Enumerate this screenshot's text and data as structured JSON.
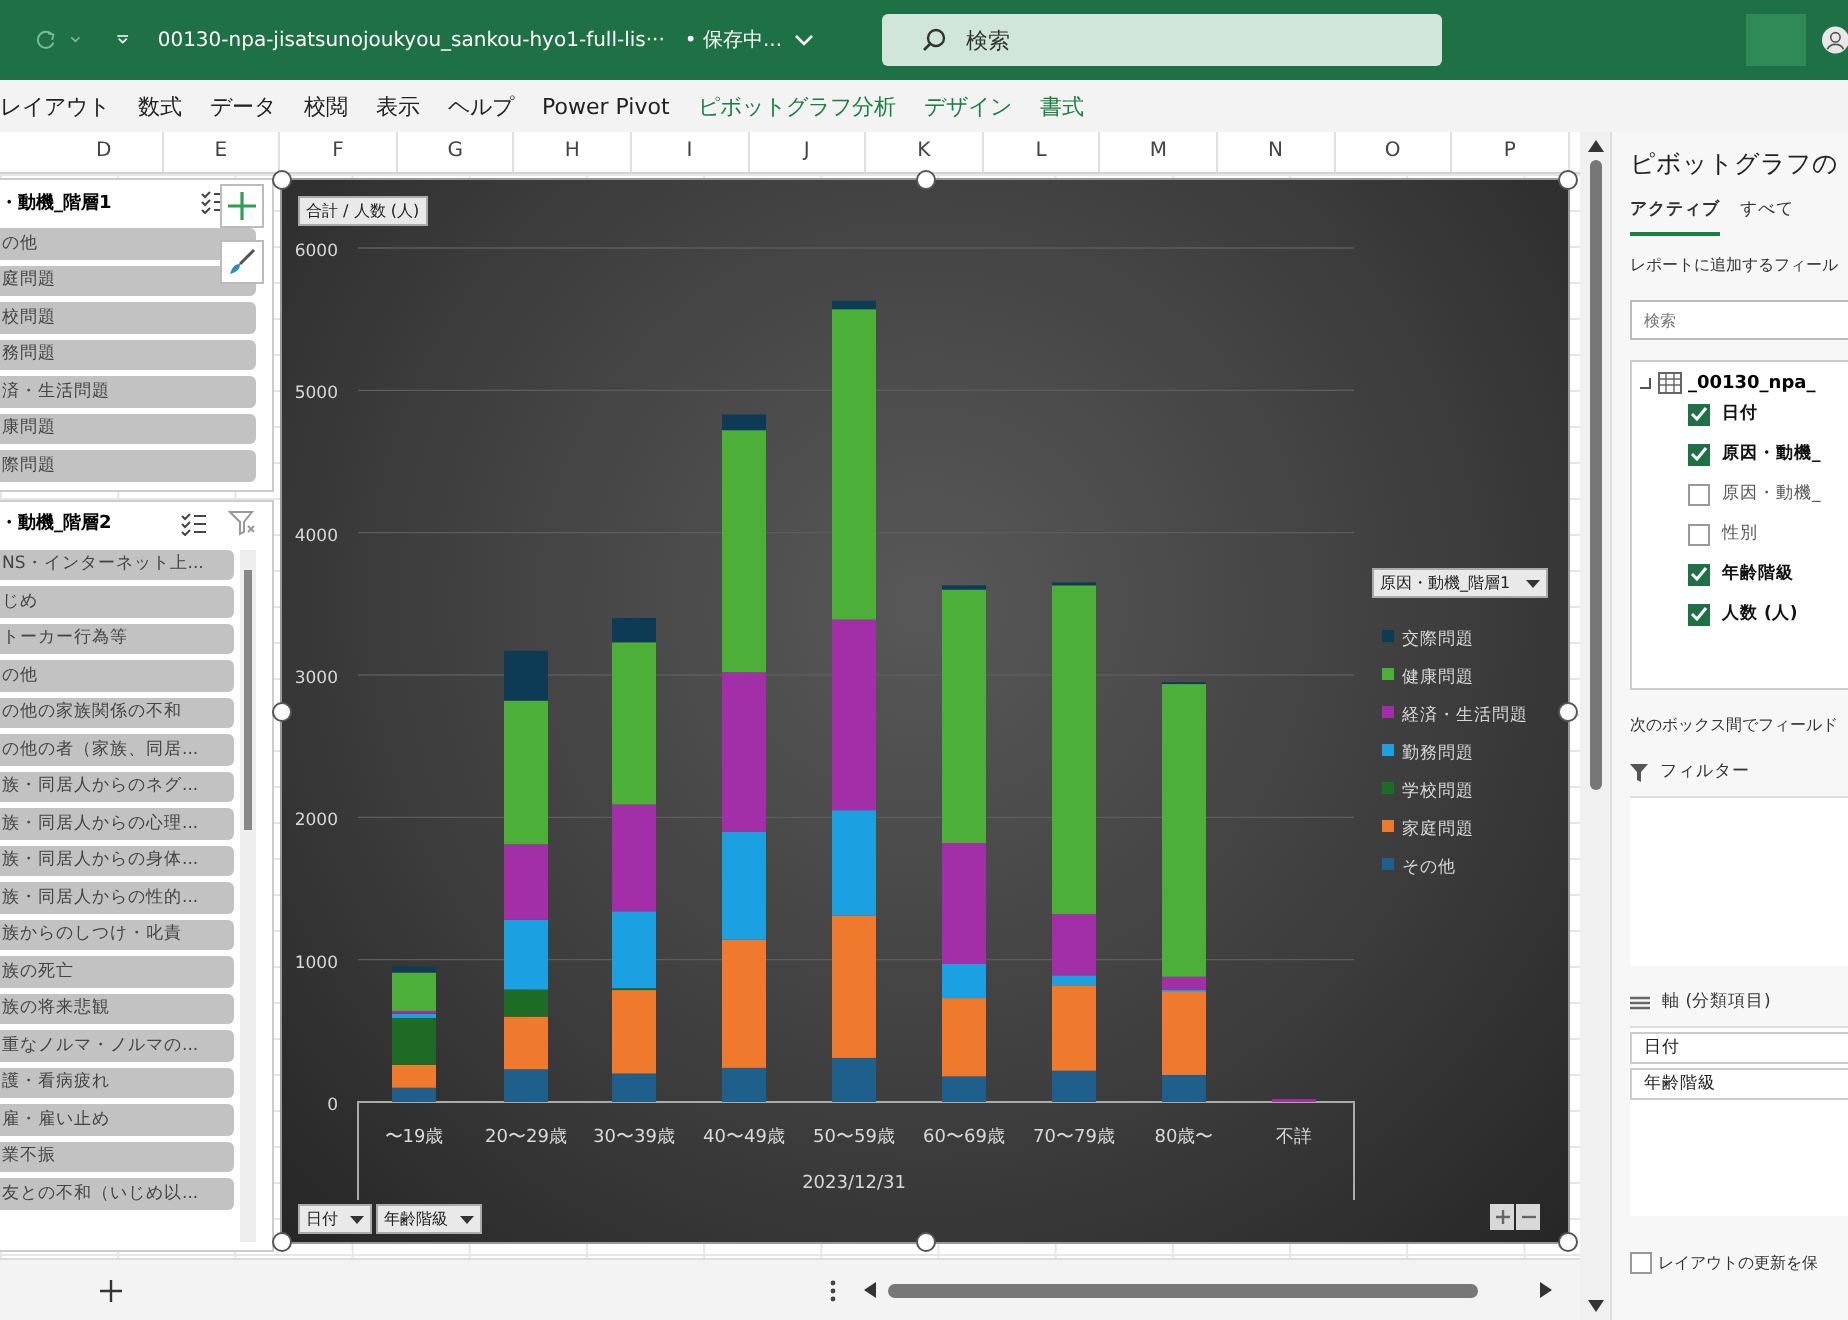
{
  "title_bar": {
    "filename": "00130-npa-jisatsunojoukyou_sankou-hyo1-full-lis···",
    "save_status": "• 保存中...",
    "search_placeholder": "検索"
  },
  "ribbon_tabs": [
    {
      "label": "レイアウト",
      "contextual": false
    },
    {
      "label": "数式",
      "contextual": false
    },
    {
      "label": "データ",
      "contextual": false
    },
    {
      "label": "校閲",
      "contextual": false
    },
    {
      "label": "表示",
      "contextual": false
    },
    {
      "label": "ヘルプ",
      "contextual": false
    },
    {
      "label": "Power Pivot",
      "contextual": false
    },
    {
      "label": "ピボットグラフ分析",
      "contextual": true
    },
    {
      "label": "デザイン",
      "contextual": true
    },
    {
      "label": "書式",
      "contextual": true
    }
  ],
  "column_headers": [
    "D",
    "E",
    "F",
    "G",
    "H",
    "I",
    "J",
    "K",
    "L",
    "M",
    "N",
    "O",
    "P"
  ],
  "slicers": [
    {
      "title": "・動機_階層1",
      "items": [
        "の他",
        "庭問題",
        "校問題",
        "務問題",
        "済・生活問題",
        "康問題",
        "際問題"
      ]
    },
    {
      "title": "・動機_階層2",
      "items": [
        "NS・インターネット上...",
        "じめ",
        "トーカー行為等",
        "の他",
        "の他の家族関係の不和",
        "の他の者（家族、同居...",
        "族・同居人からのネグ...",
        "族・同居人からの心理...",
        "族・同居人からの身体...",
        "族・同居人からの性的...",
        "族からのしつけ・叱責",
        "族の死亡",
        "族の将来悲観",
        "重なノルマ・ノルマの...",
        "護・看病疲れ",
        "雇・雇い止め",
        "業不振",
        "友との不和（いじめ以..."
      ]
    }
  ],
  "chart": {
    "value_field_button": "合計 / 人数 (人)",
    "legend_field_button": "原因・動機_階層1",
    "axis_field_buttons": [
      "日付",
      "年齢階級"
    ],
    "group_label": "2023/12/31",
    "chart_data": {
      "type": "bar",
      "stacked": true,
      "categories": [
        "〜19歳",
        "20〜29歳",
        "30〜39歳",
        "40〜49歳",
        "50〜59歳",
        "60〜69歳",
        "70〜79歳",
        "80歳〜",
        "不詳"
      ],
      "ylim": [
        0,
        6000
      ],
      "grid": true,
      "legend": true,
      "yticks": [
        0,
        1000,
        2000,
        3000,
        4000,
        5000,
        6000
      ],
      "series": [
        {
          "name": "その他",
          "color": "#1f5f8b",
          "values": [
            100,
            230,
            200,
            240,
            310,
            180,
            220,
            190,
            0
          ]
        },
        {
          "name": "家庭問題",
          "color": "#ef7a2e",
          "values": [
            160,
            370,
            590,
            900,
            1000,
            550,
            600,
            590,
            0
          ]
        },
        {
          "name": "学校問題",
          "color": "#1e6b25",
          "values": [
            330,
            190,
            10,
            0,
            0,
            0,
            0,
            0,
            0
          ]
        },
        {
          "name": "勤務問題",
          "color": "#1ba1e2",
          "values": [
            30,
            490,
            540,
            760,
            740,
            240,
            70,
            10,
            0
          ]
        },
        {
          "name": "経済・生活問題",
          "color": "#a22fa8",
          "values": [
            20,
            530,
            750,
            1120,
            1340,
            850,
            430,
            90,
            20
          ]
        },
        {
          "name": "健康問題",
          "color": "#4caf38",
          "values": [
            270,
            1010,
            1140,
            1700,
            2180,
            1780,
            2310,
            2060,
            0
          ]
        },
        {
          "name": "交際問題",
          "color": "#0d3a55",
          "values": [
            40,
            350,
            170,
            110,
            60,
            30,
            20,
            10,
            0
          ]
        }
      ]
    }
  },
  "field_pane": {
    "title": "ピボットグラフの",
    "tabs": [
      {
        "label": "アクティブ",
        "selected": true
      },
      {
        "label": "すべて",
        "selected": false
      }
    ],
    "instruction": "レポートに追加するフィール",
    "search_placeholder": "検索",
    "table_name": "_00130_npa_",
    "fields": [
      {
        "label": "日付",
        "checked": true
      },
      {
        "label": "原因・動機_",
        "checked": true
      },
      {
        "label": "原因・動機_",
        "checked": false
      },
      {
        "label": "性別",
        "checked": false
      },
      {
        "label": "年齢階級",
        "checked": true
      },
      {
        "label": "人数 (人)",
        "checked": true
      }
    ],
    "areas_instruction": "次のボックス間でフィールド",
    "filter_area": {
      "title": "フィルター"
    },
    "axis_area": {
      "title": "軸 (分類項目)",
      "items": [
        "日付",
        "年齢階級"
      ]
    },
    "defer_update": {
      "label": "レイアウトの更新を保",
      "checked": false
    }
  }
}
